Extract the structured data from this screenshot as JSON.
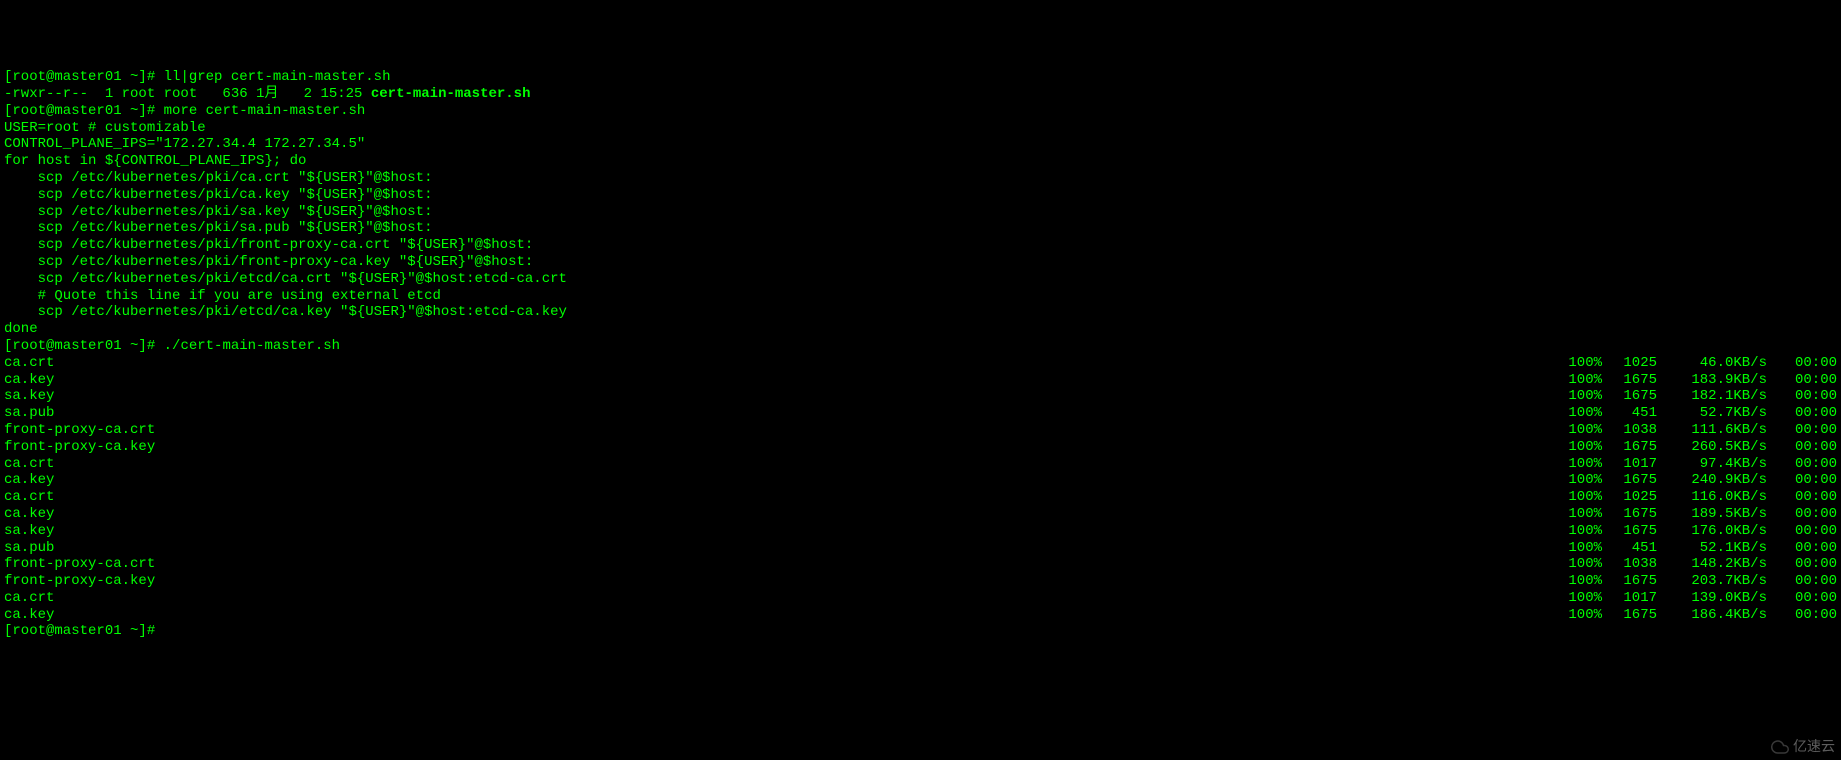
{
  "prompt": "[root@master01 ~]# ",
  "cmd1": "ll|grep cert-main-master.sh",
  "ls_out_prefix": "-rwxr--r--  1 root root   636 1月   2 15:25 ",
  "ls_out_highlight": "cert-main-master.sh",
  "cmd2": "more cert-main-master.sh",
  "script_lines": [
    "USER=root # customizable",
    "CONTROL_PLANE_IPS=\"172.27.34.4 172.27.34.5\"",
    "for host in ${CONTROL_PLANE_IPS}; do",
    "    scp /etc/kubernetes/pki/ca.crt \"${USER}\"@$host:",
    "    scp /etc/kubernetes/pki/ca.key \"${USER}\"@$host:",
    "    scp /etc/kubernetes/pki/sa.key \"${USER}\"@$host:",
    "    scp /etc/kubernetes/pki/sa.pub \"${USER}\"@$host:",
    "    scp /etc/kubernetes/pki/front-proxy-ca.crt \"${USER}\"@$host:",
    "    scp /etc/kubernetes/pki/front-proxy-ca.key \"${USER}\"@$host:",
    "    scp /etc/kubernetes/pki/etcd/ca.crt \"${USER}\"@$host:etcd-ca.crt",
    "    # Quote this line if you are using external etcd",
    "    scp /etc/kubernetes/pki/etcd/ca.key \"${USER}\"@$host:etcd-ca.key",
    "done"
  ],
  "cmd3": "./cert-main-master.sh",
  "transfers": [
    {
      "name": "ca.crt",
      "pct": "100%",
      "size": "1025",
      "speed": "46.0KB/s",
      "time": "00:00"
    },
    {
      "name": "ca.key",
      "pct": "100%",
      "size": "1675",
      "speed": "183.9KB/s",
      "time": "00:00"
    },
    {
      "name": "sa.key",
      "pct": "100%",
      "size": "1675",
      "speed": "182.1KB/s",
      "time": "00:00"
    },
    {
      "name": "sa.pub",
      "pct": "100%",
      "size": "451",
      "speed": "52.7KB/s",
      "time": "00:00"
    },
    {
      "name": "front-proxy-ca.crt",
      "pct": "100%",
      "size": "1038",
      "speed": "111.6KB/s",
      "time": "00:00"
    },
    {
      "name": "front-proxy-ca.key",
      "pct": "100%",
      "size": "1675",
      "speed": "260.5KB/s",
      "time": "00:00"
    },
    {
      "name": "ca.crt",
      "pct": "100%",
      "size": "1017",
      "speed": "97.4KB/s",
      "time": "00:00"
    },
    {
      "name": "ca.key",
      "pct": "100%",
      "size": "1675",
      "speed": "240.9KB/s",
      "time": "00:00"
    },
    {
      "name": "ca.crt",
      "pct": "100%",
      "size": "1025",
      "speed": "116.0KB/s",
      "time": "00:00"
    },
    {
      "name": "ca.key",
      "pct": "100%",
      "size": "1675",
      "speed": "189.5KB/s",
      "time": "00:00"
    },
    {
      "name": "sa.key",
      "pct": "100%",
      "size": "1675",
      "speed": "176.0KB/s",
      "time": "00:00"
    },
    {
      "name": "sa.pub",
      "pct": "100%",
      "size": "451",
      "speed": "52.1KB/s",
      "time": "00:00"
    },
    {
      "name": "front-proxy-ca.crt",
      "pct": "100%",
      "size": "1038",
      "speed": "148.2KB/s",
      "time": "00:00"
    },
    {
      "name": "front-proxy-ca.key",
      "pct": "100%",
      "size": "1675",
      "speed": "203.7KB/s",
      "time": "00:00"
    },
    {
      "name": "ca.crt",
      "pct": "100%",
      "size": "1017",
      "speed": "139.0KB/s",
      "time": "00:00"
    },
    {
      "name": "ca.key",
      "pct": "100%",
      "size": "1675",
      "speed": "186.4KB/s",
      "time": "00:00"
    }
  ],
  "watermark": "亿速云"
}
